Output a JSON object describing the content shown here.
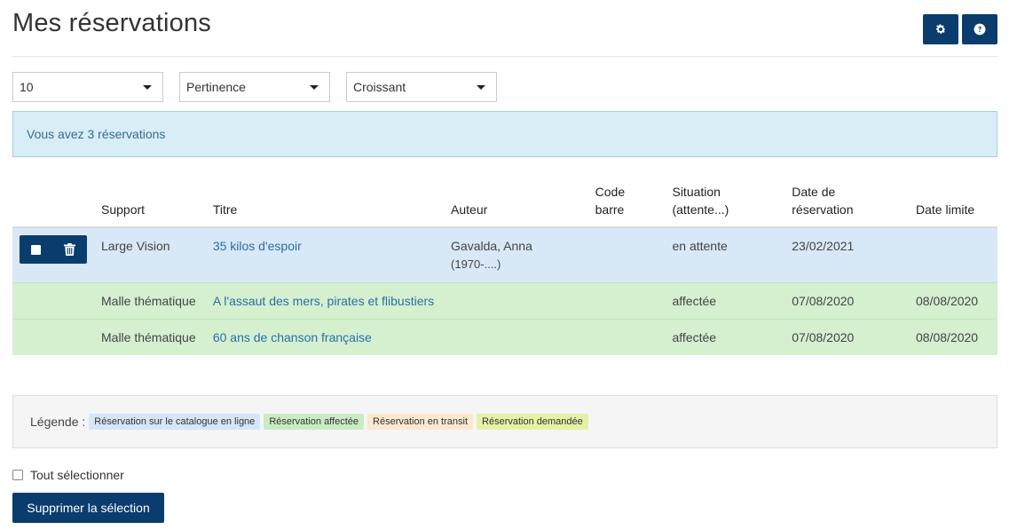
{
  "header": {
    "title": "Mes réservations"
  },
  "controls": {
    "count": "10",
    "sort": "Pertinence",
    "order": "Croissant"
  },
  "info": "Vous avez 3 réservations",
  "table": {
    "headers": {
      "support": "Support",
      "titre": "Titre",
      "auteur": "Auteur",
      "code1": "Code",
      "code2": "barre",
      "situation1": "Situation",
      "situation2": "(attente...)",
      "date1": "Date de",
      "date2": "réservation",
      "limite": "Date limite"
    },
    "rows": [
      {
        "support": "Large Vision",
        "title": "35 kilos d'espoir",
        "author1": "Gavalda, Anna",
        "author2": "(1970-....)",
        "code": "",
        "status": "en attente",
        "date": "23/02/2021",
        "limit": ""
      },
      {
        "support": "Malle thématique",
        "title": "A l'assaut des mers, pirates et flibustiers",
        "author1": "",
        "author2": "",
        "code": "",
        "status": "affectée",
        "date": "07/08/2020",
        "limit": "08/08/2020"
      },
      {
        "support": "Malle thématique",
        "title": "60 ans de chanson française",
        "author1": "",
        "author2": "",
        "code": "",
        "status": "affectée",
        "date": "07/08/2020",
        "limit": "08/08/2020"
      }
    ]
  },
  "legend": {
    "label": "Légende :",
    "items": [
      "Réservation sur le catalogue en ligne",
      "Réservation affectée",
      "Réservation en transit",
      "Réservation demandée"
    ]
  },
  "select_all": "Tout sélectionner",
  "delete_button": "Supprimer la sélection",
  "colors": {
    "primary": "#0a3d6e",
    "online": "#d8e8f7",
    "affected": "#d4f0cf",
    "transit": "#fbe8d0",
    "requested": "#e6f1a6",
    "info": "#d9edf7"
  },
  "icons": [
    "gear-icon",
    "question-icon",
    "checkbox-icon",
    "trash-icon"
  ]
}
